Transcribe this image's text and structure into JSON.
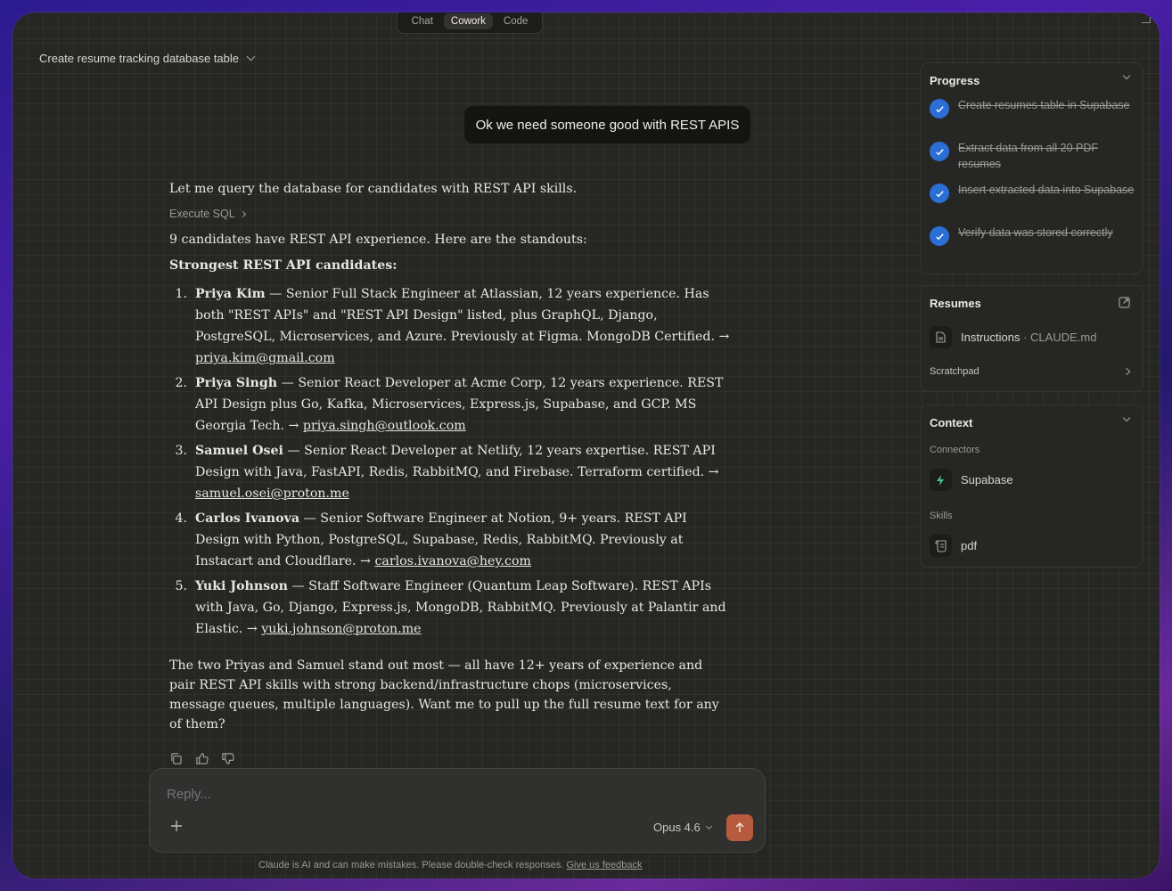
{
  "mode_tabs": [
    {
      "label": "Chat",
      "active": false
    },
    {
      "label": "Cowork",
      "active": true
    },
    {
      "label": "Code",
      "active": false
    }
  ],
  "conversation_title": "Create resume tracking database table",
  "user_message": "Ok we need someone good with REST APIS",
  "assistant": {
    "intro": "Let me query the database for candidates with REST API skills.",
    "tool_call": "Execute SQL",
    "count_line": "9 candidates have REST API experience. Here are the standouts:",
    "heading": "Strongest REST API candidates:",
    "candidates": [
      {
        "num": "1.",
        "name": "Priya Kim",
        "desc": " — Senior Full Stack Engineer at Atlassian, 12 years experience. Has both \"REST APIs\" and \"REST API Design\" listed, plus GraphQL, Django, PostgreSQL, Microservices, and Azure. Previously at Figma. MongoDB Certified. → ",
        "email": "priya.kim@gmail.com"
      },
      {
        "num": "2.",
        "name": "Priya Singh",
        "desc": " — Senior React Developer at Acme Corp, 12 years experience. REST API Design plus Go, Kafka, Microservices, Express.js, Supabase, and GCP. MS Georgia Tech. → ",
        "email": "priya.singh@outlook.com"
      },
      {
        "num": "3.",
        "name": "Samuel Osei",
        "desc": " — Senior React Developer at Netlify, 12 years expertise. REST API Design with Java, FastAPI, Redis, RabbitMQ, and Firebase. Terraform certified. → ",
        "email": "samuel.osei@proton.me"
      },
      {
        "num": "4.",
        "name": "Carlos Ivanova",
        "desc": " — Senior Software Engineer at Notion, 9+ years. REST API Design with Python, PostgreSQL, Supabase, Redis, RabbitMQ. Previously at Instacart and Cloudflare. → ",
        "email": "carlos.ivanova@hey.com"
      },
      {
        "num": "5.",
        "name": "Yuki Johnson",
        "desc": " — Staff Software Engineer (Quantum Leap Software). REST APIs with Java, Go, Django, Express.js, MongoDB, RabbitMQ. Previously at Palantir and Elastic. → ",
        "email": "yuki.johnson@proton.me"
      }
    ],
    "summary": "The two Priyas and Samuel stand out most — all have 12+ years of experience and pair REST API skills with strong backend/infrastructure chops (microservices, message queues, multiple languages). Want me to pull up the full resume text for any of them?"
  },
  "composer": {
    "placeholder": "Reply...",
    "model": "Opus 4.6"
  },
  "disclaimer": {
    "text": "Claude is AI and can make mistakes. Please double-check responses.",
    "link": "Give us feedback"
  },
  "progress": {
    "title": "Progress",
    "steps": [
      {
        "label": "Create resumes table in Supabase",
        "done": true
      },
      {
        "label": "Extract data from all 20 PDF resumes",
        "done": true
      },
      {
        "label": "Insert extracted data into Supabase",
        "done": true
      },
      {
        "label": "Verify data was stored correctly",
        "done": true
      }
    ]
  },
  "resumes": {
    "title": "Resumes",
    "file_name": "Instructions",
    "file_sep": " · ",
    "file_path": "CLAUDE.md",
    "scratchpad": "Scratchpad"
  },
  "context": {
    "title": "Context",
    "connectors_label": "Connectors",
    "connector": "Supabase",
    "skills_label": "Skills",
    "skill": "pdf"
  },
  "colors": {
    "accent_send": "#b85a3e",
    "check_blue": "#2b6fd6",
    "panel_bg": "#262624"
  }
}
